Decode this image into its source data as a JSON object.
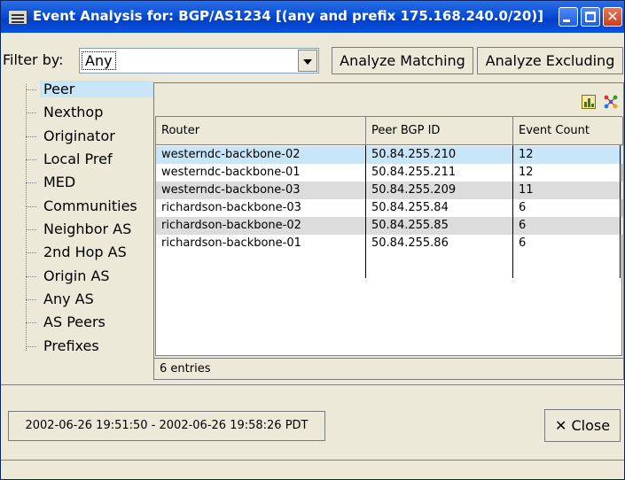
{
  "window": {
    "title": "Event Analysis for: BGP/AS1234 [(any and prefix 175.168.240.0/20)]",
    "accent_color": "#0a4fd6"
  },
  "filter": {
    "label": "Filter by:",
    "selected": "Any",
    "analyze_matching": "Analyze Matching",
    "analyze_excluding": "Analyze Excluding"
  },
  "tree": {
    "items": [
      "Peer",
      "Nexthop",
      "Originator",
      "Local Pref",
      "MED",
      "Communities",
      "Neighbor AS",
      "2nd Hop AS",
      "Origin AS",
      "Any AS",
      "AS Peers",
      "Prefixes"
    ],
    "selected_index": 0
  },
  "table": {
    "columns": [
      "Router",
      "Peer BGP ID",
      "Event Count"
    ],
    "rows": [
      [
        "westerndc-backbone-02",
        "50.84.255.210",
        "12"
      ],
      [
        "westerndc-backbone-01",
        "50.84.255.211",
        "12"
      ],
      [
        "westerndc-backbone-03",
        "50.84.255.209",
        "11"
      ],
      [
        "richardson-backbone-03",
        "50.84.255.84",
        "6"
      ],
      [
        "richardson-backbone-02",
        "50.84.255.85",
        "6"
      ],
      [
        "richardson-backbone-01",
        "50.84.255.86",
        "6"
      ]
    ],
    "status": "6 entries",
    "toolbar_icons": [
      "bar-chart-icon",
      "network-graph-icon"
    ]
  },
  "footer": {
    "time_range": "2002-06-26 19:51:50 - 2002-06-26 19:58:26 PDT",
    "close_label": "Close",
    "close_icon": "x-icon"
  }
}
